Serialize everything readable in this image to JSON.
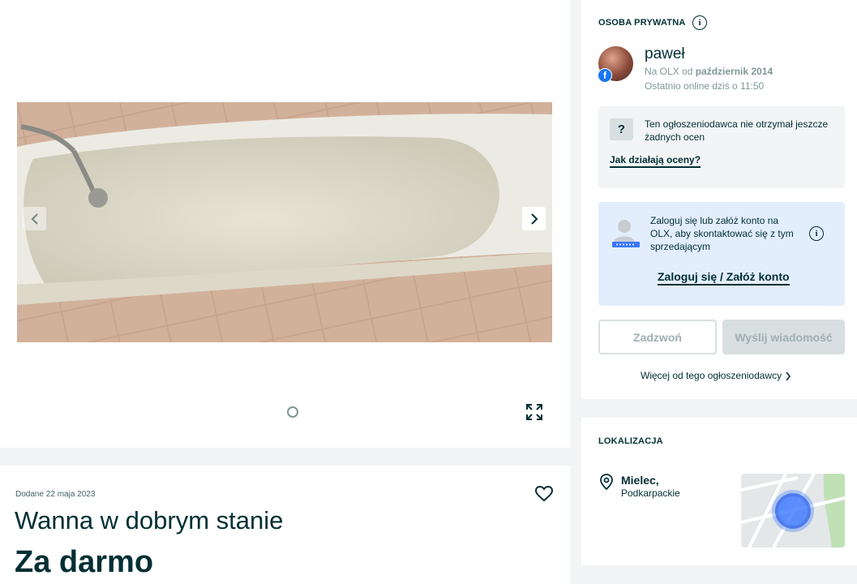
{
  "gallery": {
    "prev_icon": "chevron-left-icon",
    "next_icon": "chevron-right-icon",
    "fullscreen_icon": "expand-icon"
  },
  "listing": {
    "added": "Dodane 22 maja 2023",
    "title": "Wanna w dobrym stanie",
    "price": "Za darmo",
    "favorite_icon": "heart-icon"
  },
  "seller": {
    "section_label": "OSOBA PRYWATNA",
    "name": "paweł",
    "since_prefix": "Na OLX od ",
    "since_date": "październik 2014",
    "last_online": "Ostatnio online dziś o 11:50",
    "ratings_text": "Ten ogłoszeniodawca nie otrzymał jeszcze żadnych ocen",
    "ratings_link": "Jak działają oceny?",
    "login_text": "Zaloguj się lub załóż konto na OLX, aby skontaktować się z tym sprzedającym",
    "login_link": "Zaloguj się / Załóż konto",
    "call_button": "Zadzwoń",
    "message_button": "Wyślij wiadomość",
    "more_link": "Więcej od tego ogłoszeniodawcy"
  },
  "location": {
    "section_label": "LOKALIZACJA",
    "city": "Mielec,",
    "region": "Podkarpackie"
  },
  "colors": {
    "text": "#002f34",
    "muted": "#7f9799",
    "login_bg": "#e3eefc",
    "disabled_btn": "#d8dfe0"
  }
}
